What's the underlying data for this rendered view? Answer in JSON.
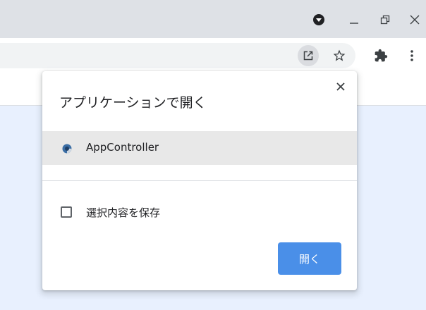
{
  "window": {
    "controls": {
      "profile_icon": "profile-dot-icon",
      "minimize_icon": "minimize-icon",
      "restore_icon": "restore-icon",
      "close_icon": "close-icon"
    }
  },
  "toolbar": {
    "icons": [
      "open-in-app-icon",
      "bookmark-star-icon",
      "extensions-puzzle-icon",
      "more-vert-icon"
    ]
  },
  "dialog": {
    "title": "アプリケーションで開く",
    "close_icon": "close-icon",
    "apps": [
      {
        "label": "AppController",
        "icon": "app-controller-icon"
      }
    ],
    "remember_label": "選択内容を保存",
    "remember_checked": false,
    "open_button": "開く"
  },
  "colors": {
    "titlebar": "#dee1e6",
    "omnibox": "#f1f3f4",
    "page_background": "#e8f0fe",
    "selected_row": "#e8e8e8",
    "primary_button": "#4a8fe8"
  }
}
